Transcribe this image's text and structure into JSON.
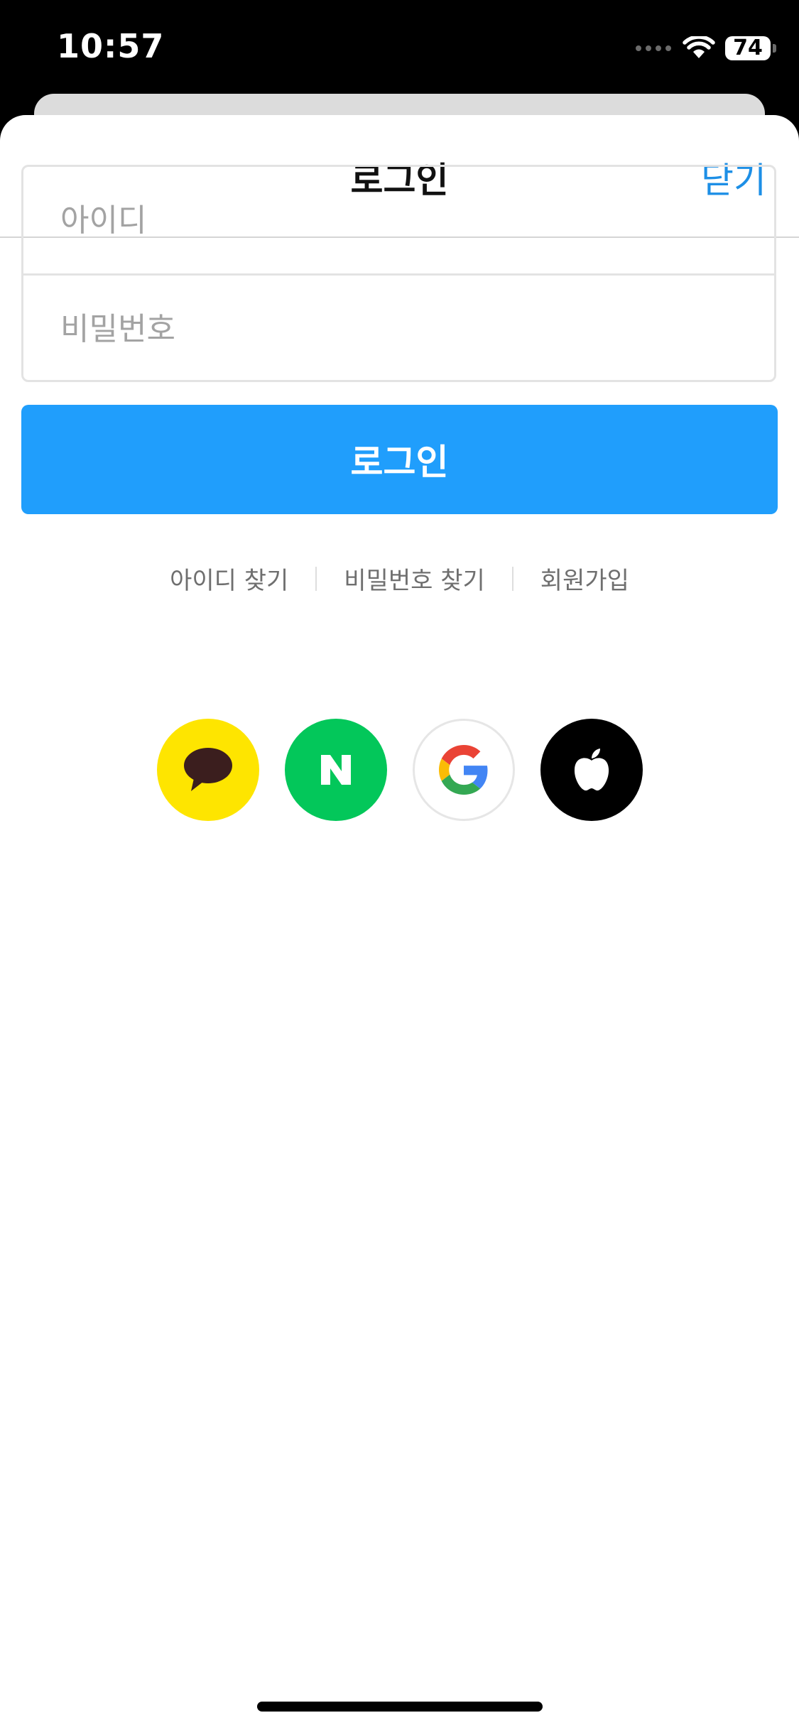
{
  "status_bar": {
    "time": "10:57",
    "battery": "74"
  },
  "header": {
    "title": "로그인",
    "close_label": "닫기"
  },
  "form": {
    "id_placeholder": "아이디",
    "password_placeholder": "비밀번호",
    "login_label": "로그인"
  },
  "links": {
    "find_id": "아이디 찾기",
    "find_password": "비밀번호 찾기",
    "signup": "회원가입"
  },
  "social": [
    {
      "icon": "kakao-talk-icon",
      "color": "#fee500"
    },
    {
      "icon": "naver-icon",
      "color": "#03c75a"
    },
    {
      "icon": "google-icon",
      "color": "#ffffff"
    },
    {
      "icon": "apple-icon",
      "color": "#000000"
    }
  ],
  "colors": {
    "accent": "#209efc",
    "close_link": "#1d8fe6"
  }
}
